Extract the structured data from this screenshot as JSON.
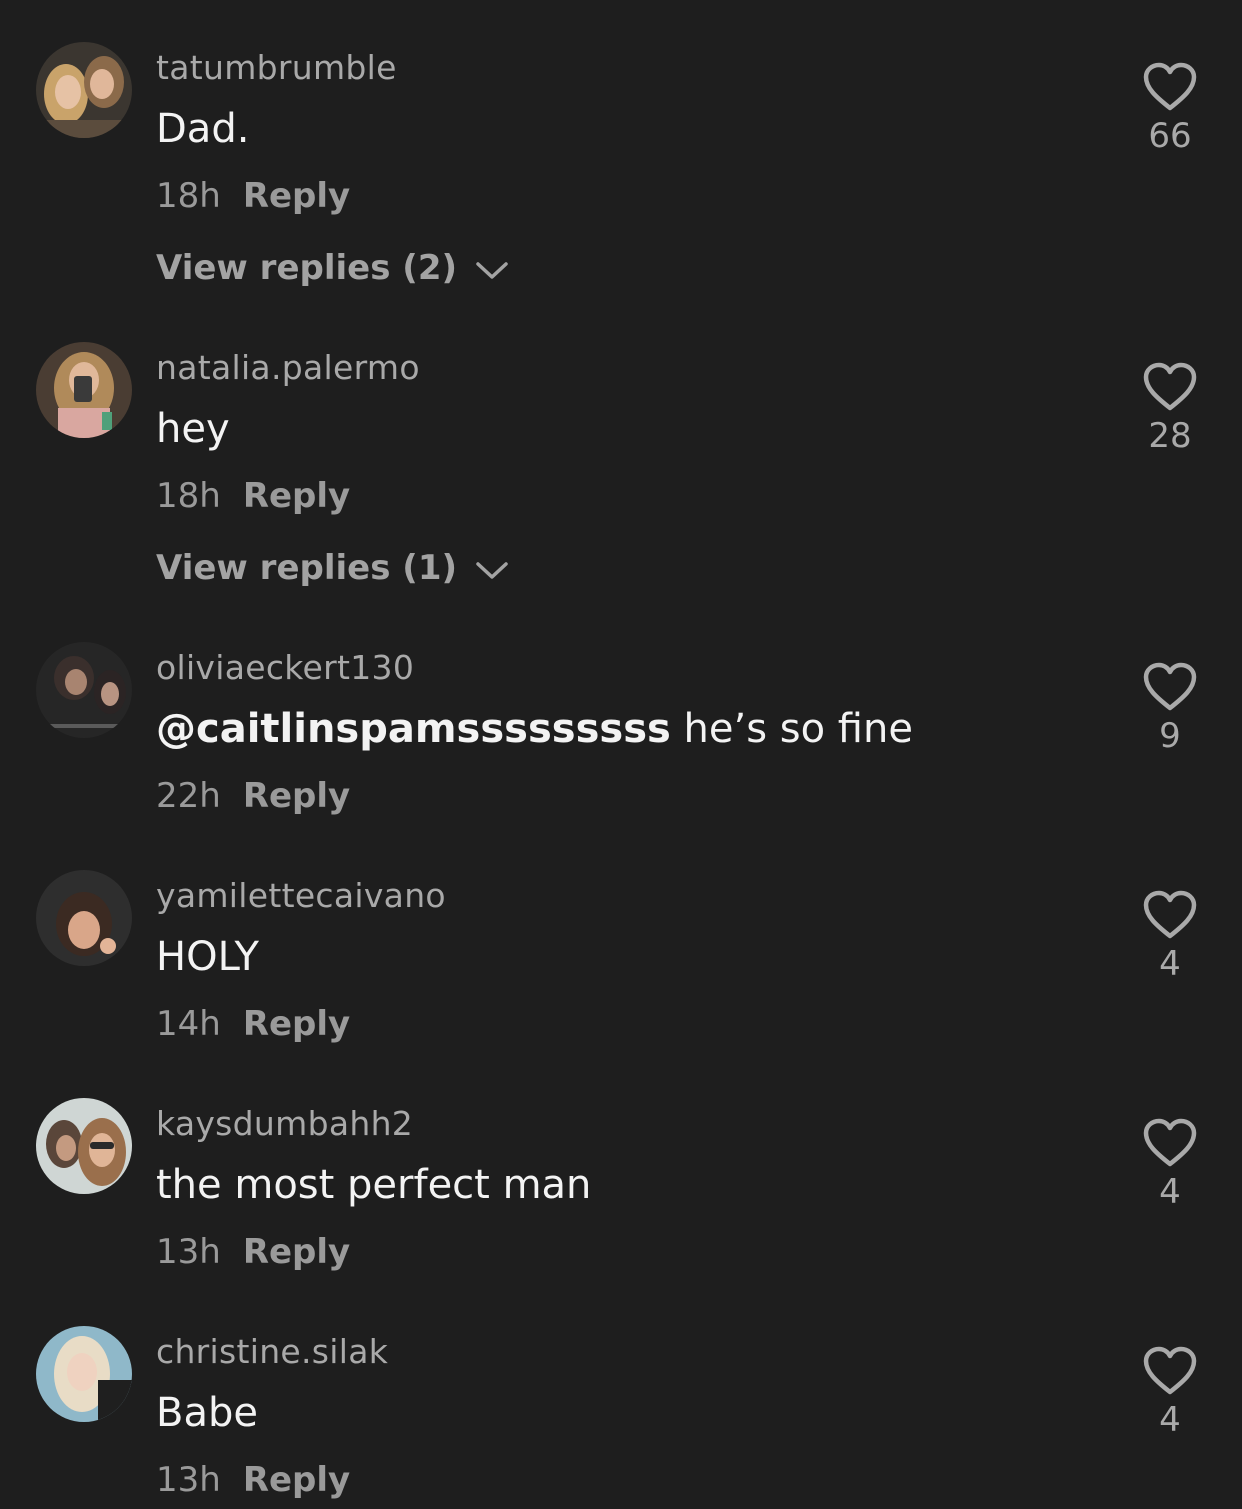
{
  "colors": {
    "background": "#1e1e1e",
    "username": "#a9a9a9",
    "text": "#f3f3f3",
    "meta": "#9a9a9a"
  },
  "icons": {
    "like": "heart-outline-icon",
    "expand": "chevron-down-icon"
  },
  "comments": [
    {
      "username": "tatumbrumble",
      "mention": "",
      "text": "Dad.",
      "time": "18h",
      "reply_label": "Reply",
      "view_replies": "View replies (2)",
      "likes": "66"
    },
    {
      "username": "natalia.palermo",
      "mention": "",
      "text": "hey",
      "time": "18h",
      "reply_label": "Reply",
      "view_replies": "View replies (1)",
      "likes": "28"
    },
    {
      "username": "oliviaeckert130",
      "mention": "@caitlinspamsssssssss",
      "text": "he’s so fine",
      "time": "22h",
      "reply_label": "Reply",
      "view_replies": "",
      "likes": "9"
    },
    {
      "username": "yamilettecaivano",
      "mention": "",
      "text": "HOLY",
      "time": "14h",
      "reply_label": "Reply",
      "view_replies": "",
      "likes": "4"
    },
    {
      "username": "kaysdumbahh2",
      "mention": "",
      "text": "the most perfect man",
      "time": "13h",
      "reply_label": "Reply",
      "view_replies": "",
      "likes": "4"
    },
    {
      "username": "christine.silak",
      "mention": "",
      "text": "Babe",
      "time": "13h",
      "reply_label": "Reply",
      "view_replies": "",
      "likes": "4"
    }
  ]
}
